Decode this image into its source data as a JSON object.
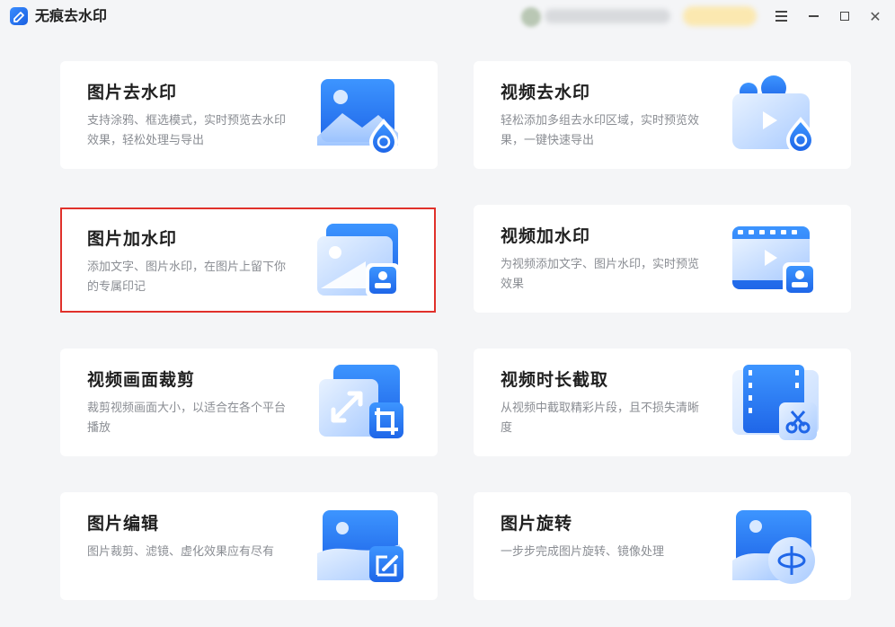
{
  "app": {
    "title": "无痕去水印"
  },
  "colors": {
    "accent": "#2a7cf6",
    "selected_border": "#e0312b",
    "background": "#f4f5f7"
  },
  "window_controls": {
    "menu_icon": "hamburger-icon",
    "minimize_icon": "minimize-icon",
    "maximize_icon": "maximize-icon",
    "close_icon": "close-icon",
    "close_glyph": "✕"
  },
  "cards": [
    {
      "title": "图片去水印",
      "desc": "支持涂鸦、框选模式，实时预览去水印效果，轻松处理与导出",
      "icon": "image-remove-watermark-icon",
      "selected": false
    },
    {
      "title": "视频去水印",
      "desc": "轻松添加多组去水印区域，实时预览效果，一键快速导出",
      "icon": "video-remove-watermark-icon",
      "selected": false
    },
    {
      "title": "图片加水印",
      "desc": "添加文字、图片水印，在图片上留下你的专属印记",
      "icon": "image-add-watermark-icon",
      "selected": true
    },
    {
      "title": "视频加水印",
      "desc": "为视频添加文字、图片水印，实时预览效果",
      "icon": "video-add-watermark-icon",
      "selected": false
    },
    {
      "title": "视频画面裁剪",
      "desc": "裁剪视频画面大小，以适合在各个平台播放",
      "icon": "video-crop-icon",
      "selected": false
    },
    {
      "title": "视频时长截取",
      "desc": "从视频中截取精彩片段，且不损失清晰度",
      "icon": "video-trim-icon",
      "selected": false
    },
    {
      "title": "图片编辑",
      "desc": "图片裁剪、滤镜、虚化效果应有尽有",
      "icon": "image-edit-icon",
      "selected": false
    },
    {
      "title": "图片旋转",
      "desc": "一步步完成图片旋转、镜像处理",
      "icon": "image-rotate-icon",
      "selected": false
    }
  ]
}
